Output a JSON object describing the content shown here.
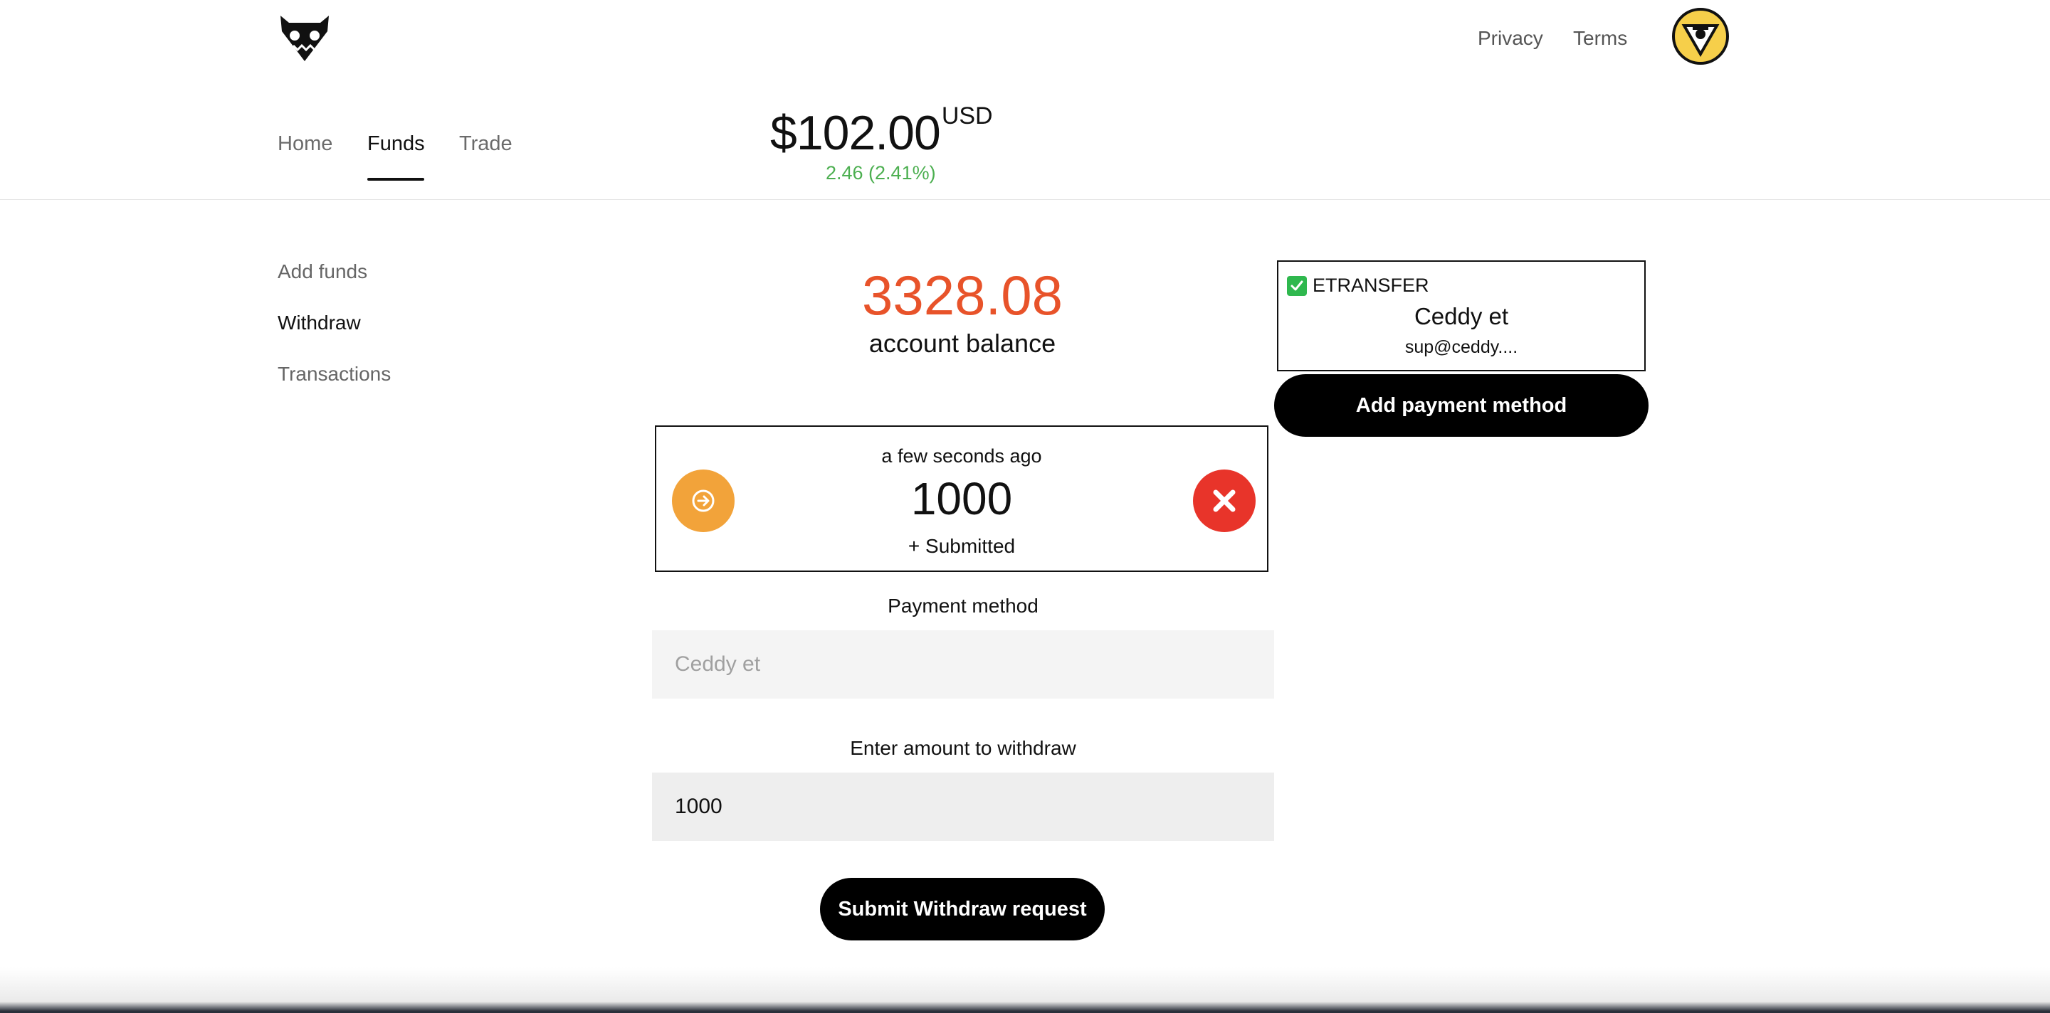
{
  "header": {
    "privacy_label": "Privacy",
    "terms_label": "Terms"
  },
  "nav": {
    "tabs": [
      {
        "label": "Home",
        "active": false
      },
      {
        "label": "Funds",
        "active": true
      },
      {
        "label": "Trade",
        "active": false
      }
    ]
  },
  "portfolio": {
    "amount": "$102.00",
    "currency": "USD",
    "change": "2.46 (2.41%)",
    "change_color": "#4caf50"
  },
  "sidebar": {
    "items": [
      {
        "label": "Add funds",
        "active": false
      },
      {
        "label": "Withdraw",
        "active": true
      },
      {
        "label": "Transactions",
        "active": false
      }
    ]
  },
  "account": {
    "balance": "3328.08",
    "balance_color": "#e8532a",
    "label": "account balance"
  },
  "transaction": {
    "time": "a few seconds ago",
    "amount": "1000",
    "status": "+ Submitted",
    "left_icon": "arrow-right-circle-icon",
    "right_icon": "close-icon"
  },
  "payment_card": {
    "type": "ETRANSFER",
    "name": "Ceddy et",
    "email": "sup@ceddy...."
  },
  "add_payment_label": "Add payment method",
  "form": {
    "payment_method_label": "Payment method",
    "payment_method_placeholder": "Ceddy et",
    "amount_label": "Enter amount to withdraw",
    "amount_value": "1000",
    "submit_label": "Submit Withdraw request"
  }
}
